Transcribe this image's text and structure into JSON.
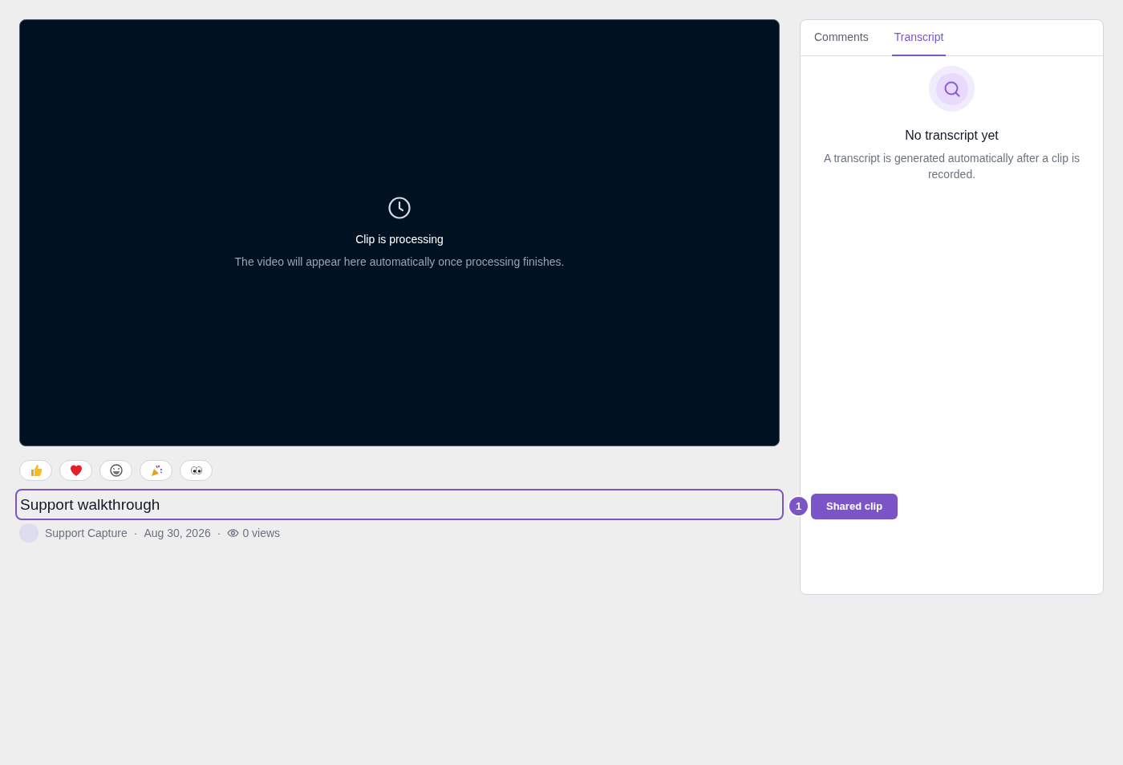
{
  "video": {
    "status_title": "Clip is processing",
    "status_text": "The video will appear here automatically once processing finishes."
  },
  "reactions": [
    {
      "kind": "thumbs-up"
    },
    {
      "kind": "heart"
    },
    {
      "kind": "laugh"
    },
    {
      "kind": "party"
    },
    {
      "kind": "eyes"
    }
  ],
  "title": {
    "value": "Support walkthrough",
    "highlighted": true
  },
  "annotation": {
    "number": "1",
    "label": "Shared clip"
  },
  "meta": {
    "author": "Support Capture",
    "separator_1": "·",
    "date": "Aug 30, 2026",
    "separator_2": "·",
    "views": "0 views"
  },
  "tabs": [
    {
      "label": "Comments",
      "selected": false
    },
    {
      "label": "Transcript",
      "selected": true
    }
  ],
  "empty_state": {
    "title": "No transcript yet",
    "text": "A transcript is generated automatically after a clip is recorded."
  }
}
